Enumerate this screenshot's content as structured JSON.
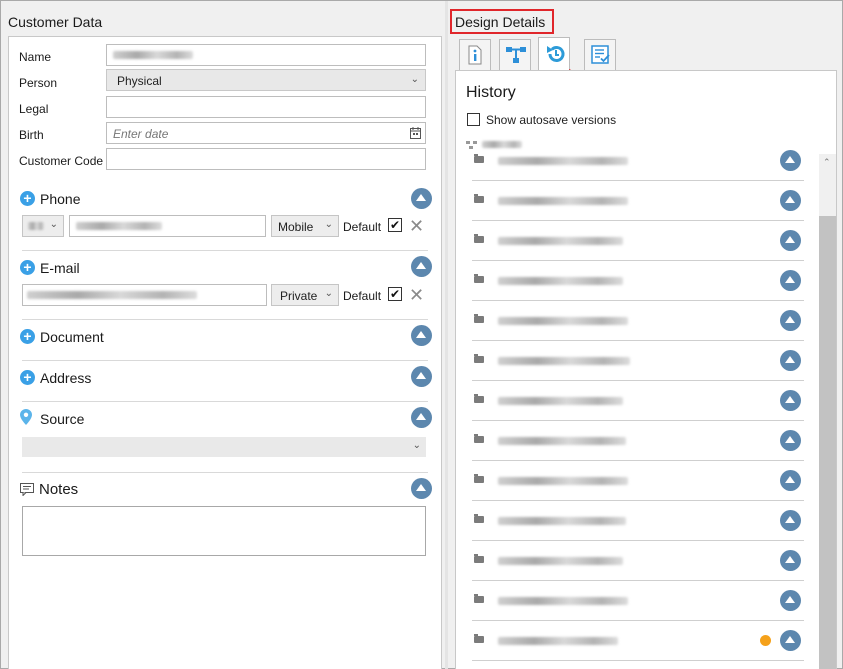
{
  "left": {
    "title": "Customer Data",
    "fields": {
      "name_label": "Name",
      "person_label": "Person",
      "person_value": "Physical",
      "legal_label": "Legal",
      "birth_label": "Birth",
      "birth_placeholder": "Enter date",
      "customer_code_label": "Customer Code"
    },
    "sections": {
      "phone": "Phone",
      "email": "E-mail",
      "document": "Document",
      "address": "Address",
      "source": "Source",
      "notes": "Notes"
    },
    "phone": {
      "type": "Mobile",
      "default_label": "Default",
      "default_checked": true
    },
    "email": {
      "type": "Private",
      "default_label": "Default",
      "default_checked": true
    }
  },
  "right": {
    "title": "Design Details",
    "tabs": [
      {
        "icon": "info-icon",
        "active": false
      },
      {
        "icon": "structure-icon",
        "active": false
      },
      {
        "icon": "history-icon",
        "active": true
      },
      {
        "icon": "checklist-icon",
        "active": false
      }
    ],
    "history_title": "History",
    "show_autosave_label": "Show autosave versions",
    "show_autosave_checked": false,
    "history_rows": 13,
    "unsaved_dot_color": "#f5a11a"
  },
  "colors": {
    "accent": "#3aa0e6",
    "collapse": "#5c87ae",
    "highlight": "#e0262b"
  }
}
